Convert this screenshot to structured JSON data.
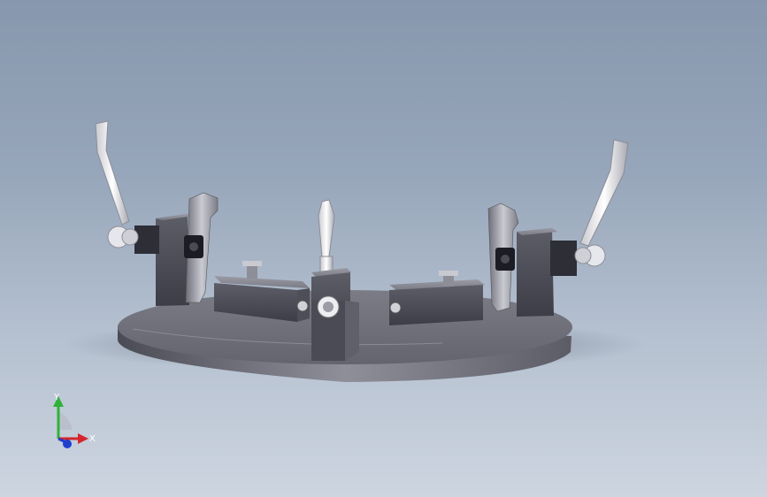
{
  "viewport": {
    "model": "welding-fixture-assembly",
    "background_top": "#8797ad",
    "background_bottom": "#cdd5e0"
  },
  "triad": {
    "x_label": "X",
    "y_label": "Y",
    "x_color": "#d4262c",
    "y_color": "#2fb13b",
    "z_color": "#1f3fcf"
  }
}
